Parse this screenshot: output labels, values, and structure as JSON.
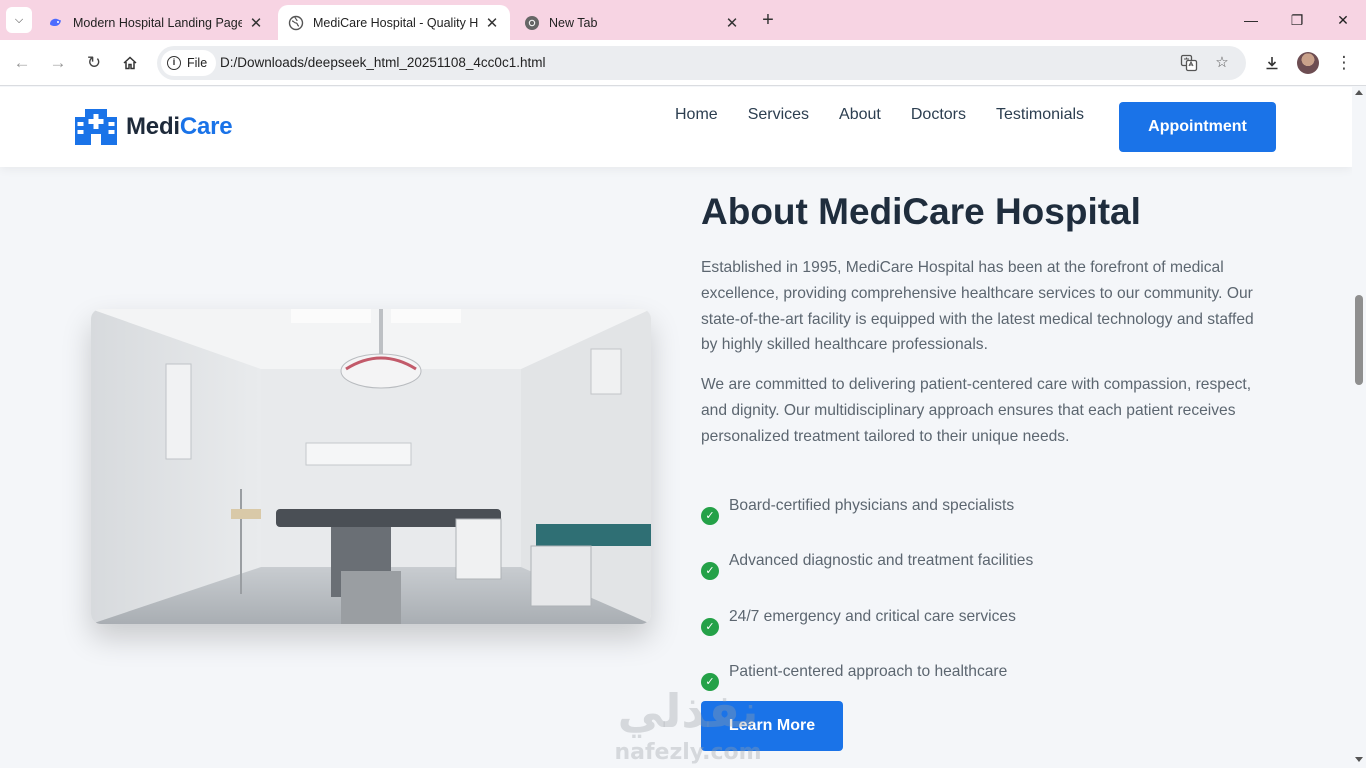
{
  "browser": {
    "tabs": [
      {
        "title": "Modern Hospital Landing Page",
        "active": false,
        "icon": "deepseek-icon"
      },
      {
        "title": "MediCare Hospital - Quality He",
        "active": true,
        "icon": "globe-icon"
      },
      {
        "title": "New Tab",
        "active": false,
        "icon": "chrome-icon"
      }
    ],
    "address": {
      "chip_label": "File",
      "url": "D:/Downloads/deepseek_html_20251108_4cc0c1.html"
    }
  },
  "site": {
    "logo": {
      "part1": "Medi",
      "part2": "Care"
    },
    "nav": [
      "Home",
      "Services",
      "About",
      "Doctors",
      "Testimonials"
    ],
    "appointment_label": "Appointment",
    "brand_color": "#1a73e8"
  },
  "about": {
    "title": "About MediCare Hospital",
    "paragraph1": "Established in 1995, MediCare Hospital has been at the forefront of medical excellence, providing comprehensive healthcare services to our community. Our state-of-the-art facility is equipped with the latest medical technology and staffed by highly skilled healthcare professionals.",
    "paragraph2": "We are committed to delivering patient-centered care with compassion, respect, and dignity. Our multidisciplinary approach ensures that each patient receives personalized treatment tailored to their unique needs.",
    "features": [
      "Board-certified physicians and specialists",
      "Advanced diagnostic and treatment facilities",
      "24/7 emergency and critical care services",
      "Patient-centered approach to healthcare"
    ],
    "learn_more_label": "Learn More",
    "check_color": "#24a148"
  },
  "watermark": {
    "arabic": "نفذلي",
    "latin": "nafezly.com"
  }
}
